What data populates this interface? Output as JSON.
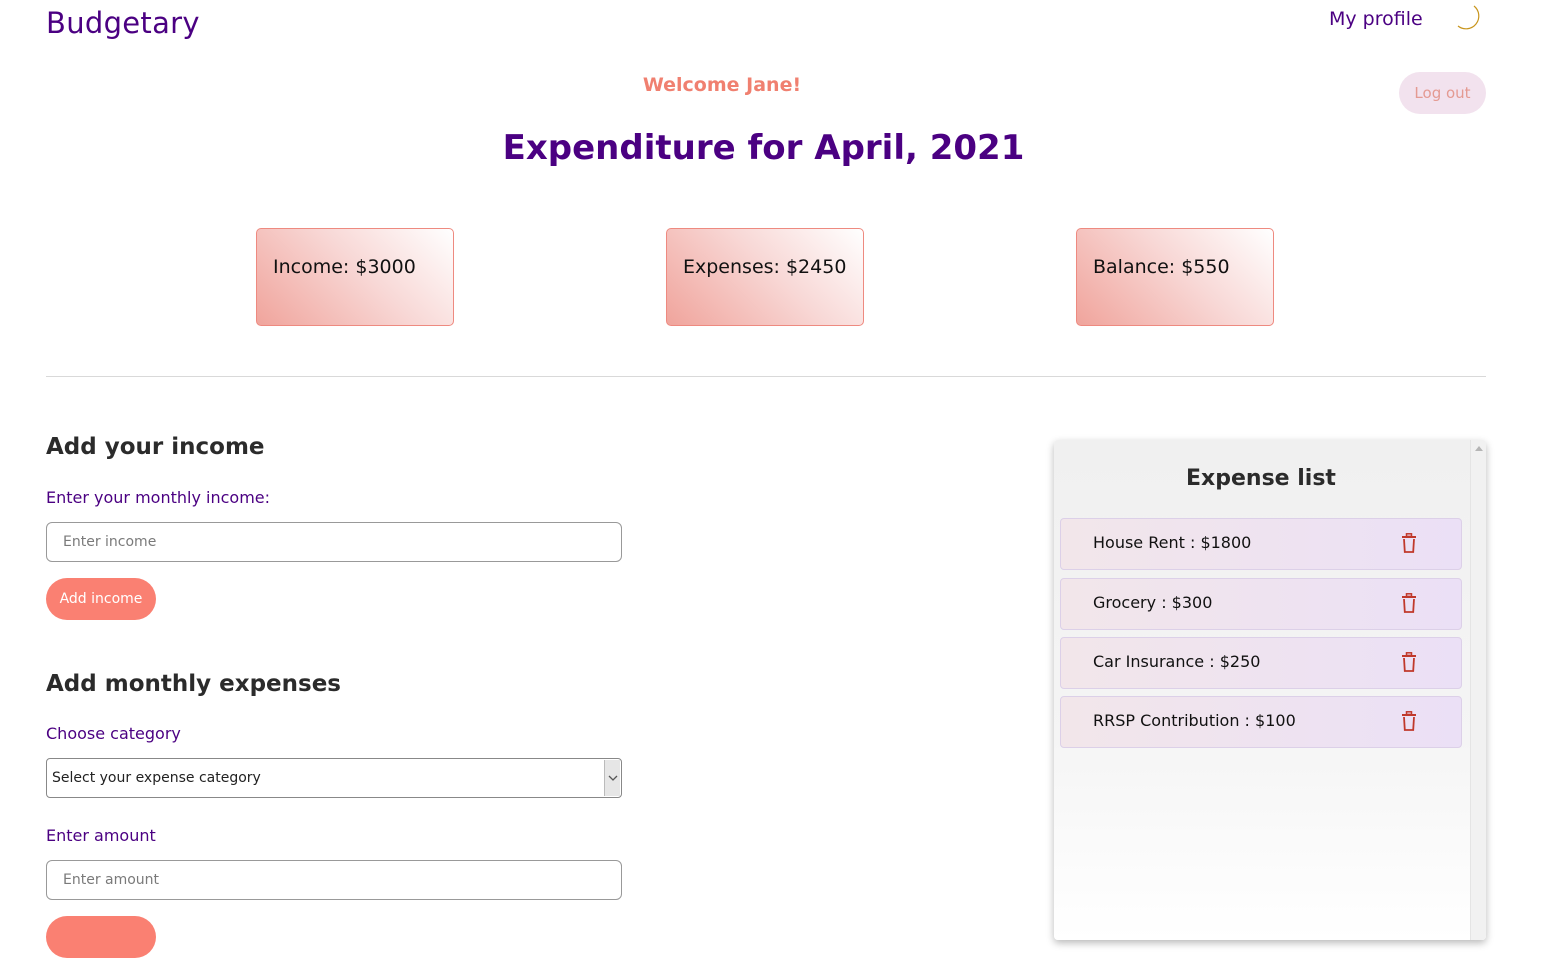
{
  "brand": {
    "name": "Budgetary"
  },
  "nav": {
    "profile_label": "My profile",
    "theme_icon": "moon-icon",
    "logout_label": "Log out"
  },
  "welcome": "Welcome Jane!",
  "heading": "Expenditure for April, 2021",
  "summary": {
    "income": "Income: $3000",
    "expenses": "Expenses: $2450",
    "balance": "Balance: $550"
  },
  "income_form": {
    "title": "Add your income",
    "label": "Enter your monthly income:",
    "placeholder": "Enter income",
    "value": "",
    "button": "Add income"
  },
  "expense_form": {
    "title": "Add monthly expenses",
    "category_label": "Choose category",
    "category_selected": "Select your expense category",
    "amount_label": "Enter amount",
    "amount_placeholder": "Enter amount",
    "amount_value": ""
  },
  "expense_list": {
    "title": "Expense list",
    "items": [
      {
        "label": "House Rent : $1800"
      },
      {
        "label": "Grocery : $300"
      },
      {
        "label": "Car Insurance : $250"
      },
      {
        "label": "RRSP Contribution : $100"
      }
    ],
    "delete_icon": "trash-icon"
  },
  "colors": {
    "brand": "#4b0082",
    "accent": "#fa8072",
    "delete": "#c0392b"
  }
}
